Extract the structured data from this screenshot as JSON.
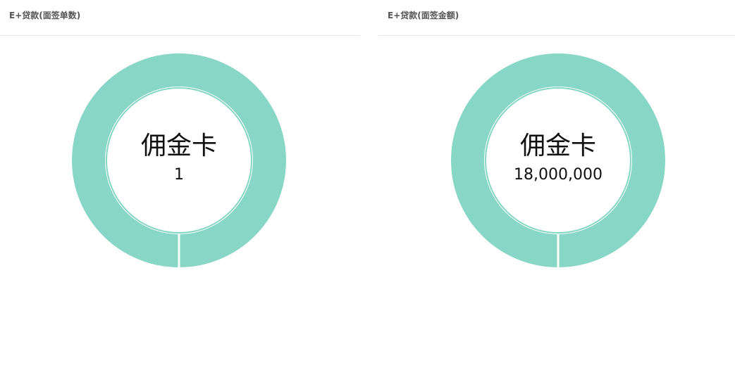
{
  "panels": [
    {
      "title": "E+贷款(面签单数)"
    },
    {
      "title": "E+贷款(面签金额)"
    }
  ],
  "chart_data": [
    {
      "type": "pie",
      "subtype": "donut",
      "title": "E+贷款(面签单数)",
      "categories": [
        "佣金卡"
      ],
      "values": [
        1
      ],
      "center_label": "佣金卡",
      "center_value": "1",
      "colors": [
        "#88d6c5"
      ]
    },
    {
      "type": "pie",
      "subtype": "donut",
      "title": "E+贷款(面签金额)",
      "categories": [
        "佣金卡"
      ],
      "values": [
        18000000
      ],
      "center_label": "佣金卡",
      "center_value": "18,000,000",
      "colors": [
        "#88d6c5"
      ]
    }
  ]
}
